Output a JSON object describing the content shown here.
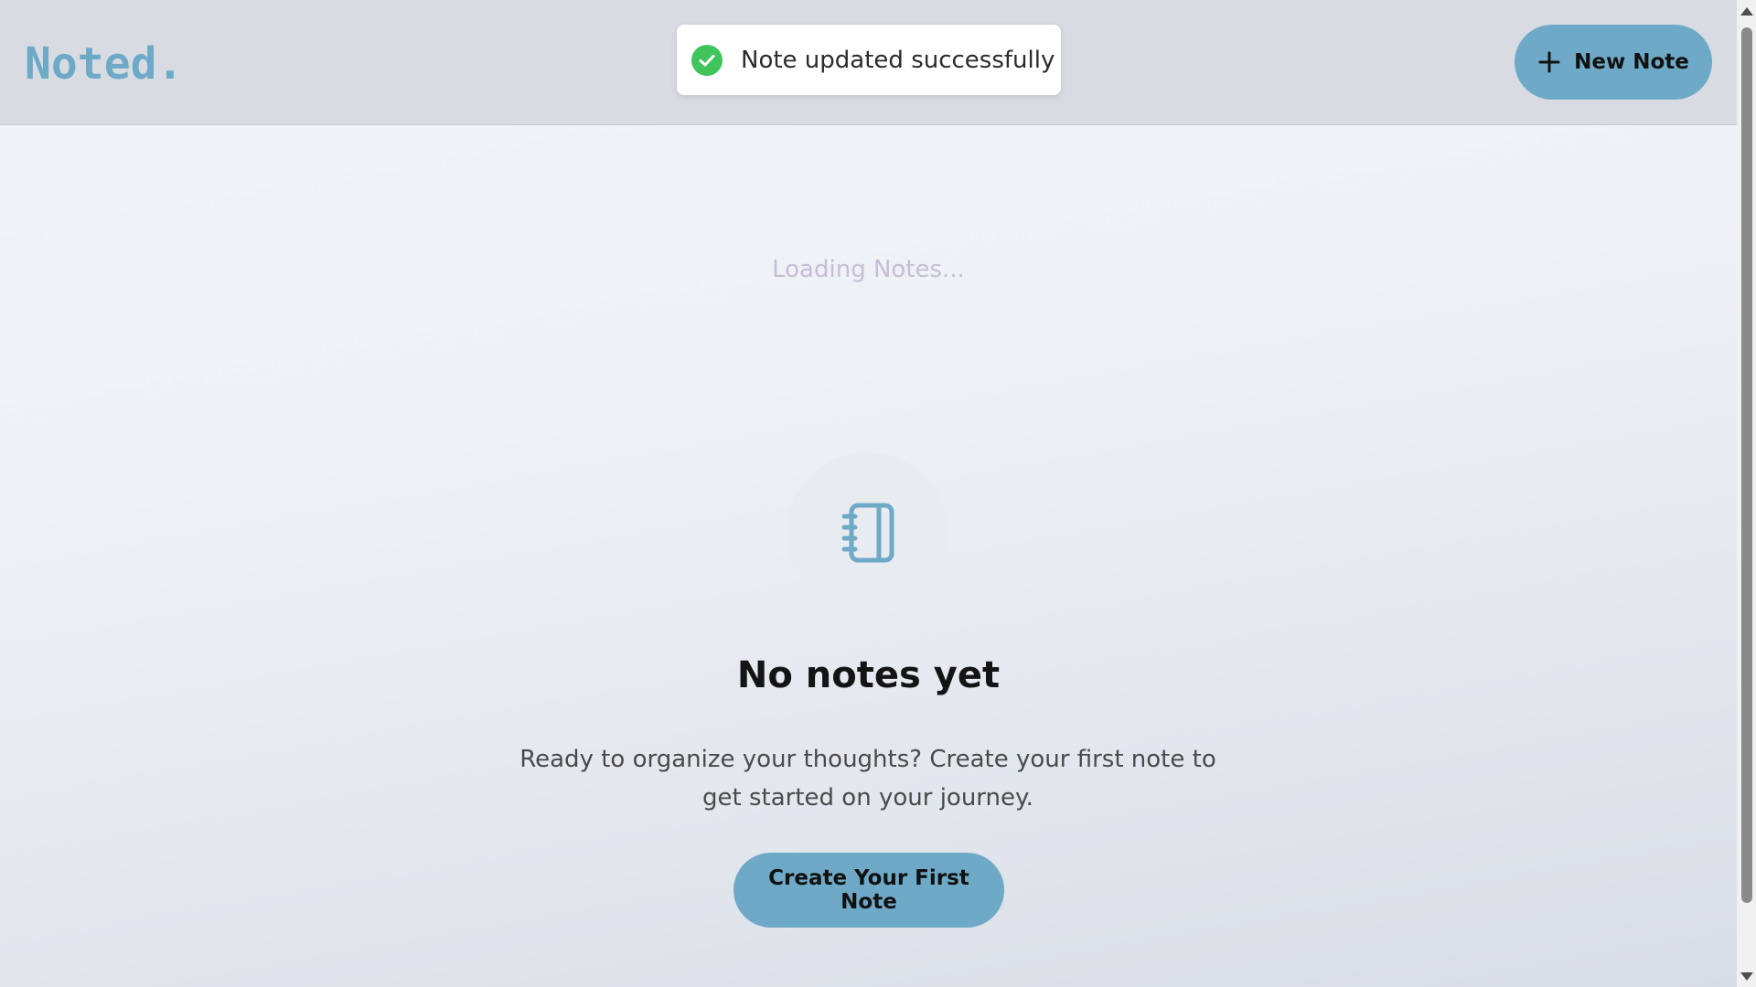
{
  "app": {
    "logo": "Noted."
  },
  "header": {
    "new_note_label": "New Note",
    "plus_icon": "plus-icon"
  },
  "toast": {
    "message": "Note updated successfully",
    "icon": "check-circle-icon",
    "icon_color": "#3fc55c"
  },
  "main": {
    "loading_text": "Loading Notes...",
    "empty_state": {
      "icon": "notebook-icon",
      "title": "No notes yet",
      "description": "Ready to organize your thoughts? Create your first note to get started on your journey.",
      "cta_label": "Create Your First Note"
    }
  },
  "colors": {
    "accent": "#6eaac7",
    "header_bg": "#d8dce2",
    "loading_text": "#c8bcd6"
  }
}
